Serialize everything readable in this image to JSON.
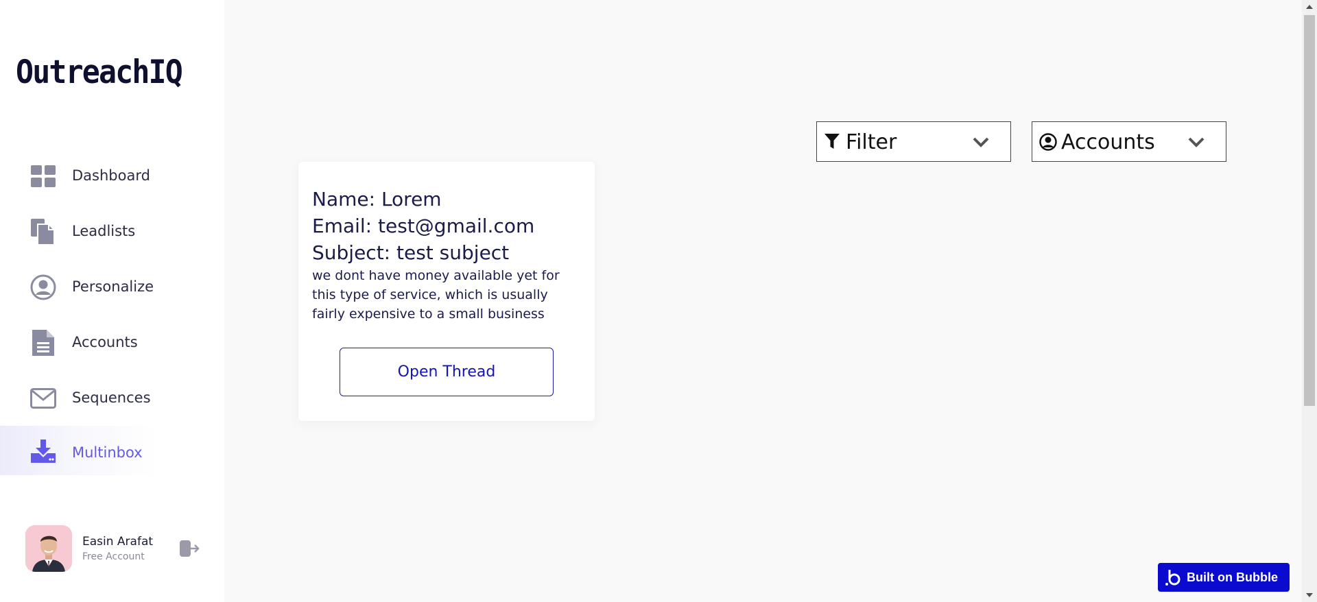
{
  "app": {
    "logo": "OutreachIQ"
  },
  "sidebar": {
    "items": [
      {
        "label": "Dashboard",
        "icon": "dashboard-icon",
        "active": false
      },
      {
        "label": "Leadlists",
        "icon": "documents-icon",
        "active": false
      },
      {
        "label": "Personalize",
        "icon": "user-circle-icon",
        "active": false
      },
      {
        "label": "Accounts",
        "icon": "file-text-icon",
        "active": false
      },
      {
        "label": "Sequences",
        "icon": "envelope-icon",
        "active": false
      },
      {
        "label": "Multinbox",
        "icon": "download-tray-icon",
        "active": true
      }
    ]
  },
  "profile": {
    "name": "Easin Arafat",
    "plan": "Free Account",
    "logout_icon": "logout-icon"
  },
  "filters": {
    "filter_label": "Filter",
    "accounts_label": "Accounts"
  },
  "card": {
    "name_line": "Name: Lorem",
    "email_line": "Email: test@gmail.com",
    "subject_line": "Subject: test subject",
    "body": "we dont have money available yet for this type of service, which is usually fairly expensive to a small business",
    "button_label": "Open Thread"
  },
  "badge": {
    "label": "Built on Bubble"
  },
  "colors": {
    "accent": "#6359e9",
    "nav_icon": "#8a8aa0",
    "button_border": "#1c1ca8",
    "badge_bg": "#0b0bd0"
  }
}
